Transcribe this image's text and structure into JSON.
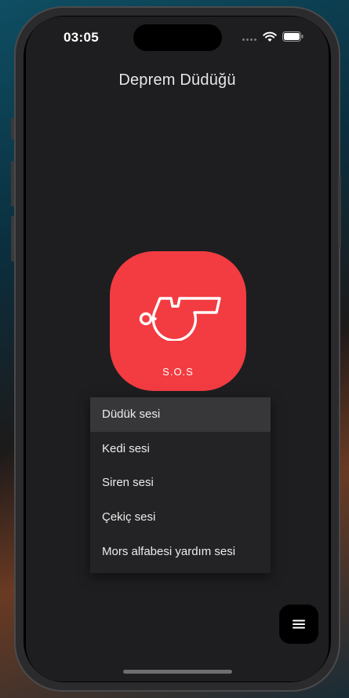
{
  "status_bar": {
    "time": "03:05",
    "signal_icon": "cellular-signal-icon",
    "wifi_icon": "wifi-icon",
    "battery_icon": "battery-icon"
  },
  "app": {
    "title": "Deprem Düdüğü"
  },
  "sos_button": {
    "label": "S.O.S",
    "icon": "whistle-icon",
    "color": "#f23c41"
  },
  "sound_menu": {
    "selected_index": 0,
    "items": [
      {
        "label": "Düdük sesi"
      },
      {
        "label": "Kedi sesi"
      },
      {
        "label": "Siren sesi"
      },
      {
        "label": "Çekiç sesi"
      },
      {
        "label": "Mors alfabesi yardım sesi"
      }
    ]
  },
  "fab": {
    "icon": "menu-icon"
  },
  "colors": {
    "background": "#1e1e20",
    "accent": "#f23c41",
    "menu_background": "#232325",
    "menu_selected": "#37373a"
  }
}
